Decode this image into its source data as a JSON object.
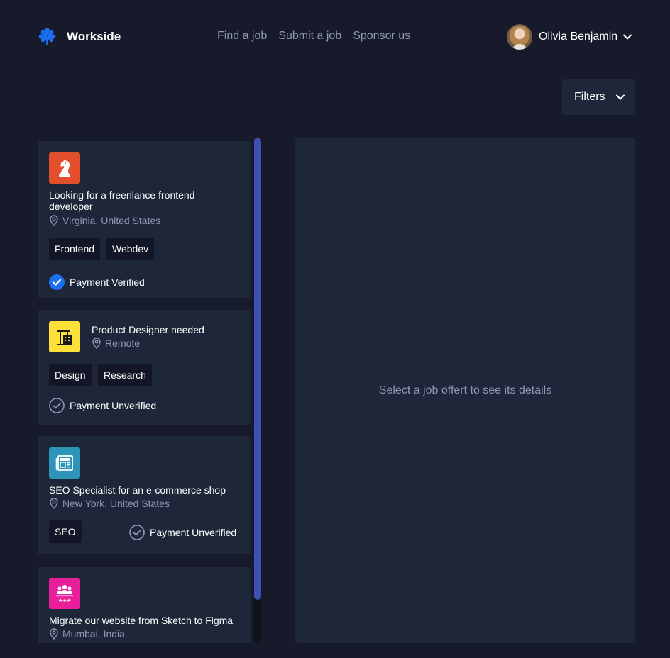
{
  "brand": {
    "name": "Workside",
    "logo_icon": "tree-icon",
    "accent": "#1c6ef2"
  },
  "nav": {
    "items": [
      "Find a job",
      "Submit a job",
      "Sponsor us"
    ]
  },
  "user": {
    "name": "Olivia Benjamin"
  },
  "filters": {
    "label": "Filters"
  },
  "jobs": [
    {
      "title": "Looking for a freenlance frontend developer",
      "location": "Virginia, United States",
      "tags": [
        "Frontend",
        "Webdev"
      ],
      "payment": "Payment Verified",
      "verified": true,
      "logo_color": "#e34f2c",
      "logo_icon": "chess-knight-icon"
    },
    {
      "title": "Product Designer needed",
      "location": "Remote",
      "tags": [
        "Design",
        "Research"
      ],
      "payment": "Payment Unverified",
      "verified": false,
      "logo_color": "#fde038",
      "logo_icon": "crane-building-icon"
    },
    {
      "title": "SEO Specialist for an e-commerce shop",
      "location": "New York, United States",
      "tags": [
        "SEO"
      ],
      "payment": "Payment Unverified",
      "verified": false,
      "logo_color": "#2c95b8",
      "logo_icon": "newspaper-press-icon"
    },
    {
      "title": "Migrate our website from Sketch to Figma",
      "location": "Mumbai, India",
      "logo_color": "#e91e9a",
      "logo_icon": "team-stars-icon"
    }
  ],
  "detail": {
    "placeholder": "Select a job offert to see its details"
  }
}
